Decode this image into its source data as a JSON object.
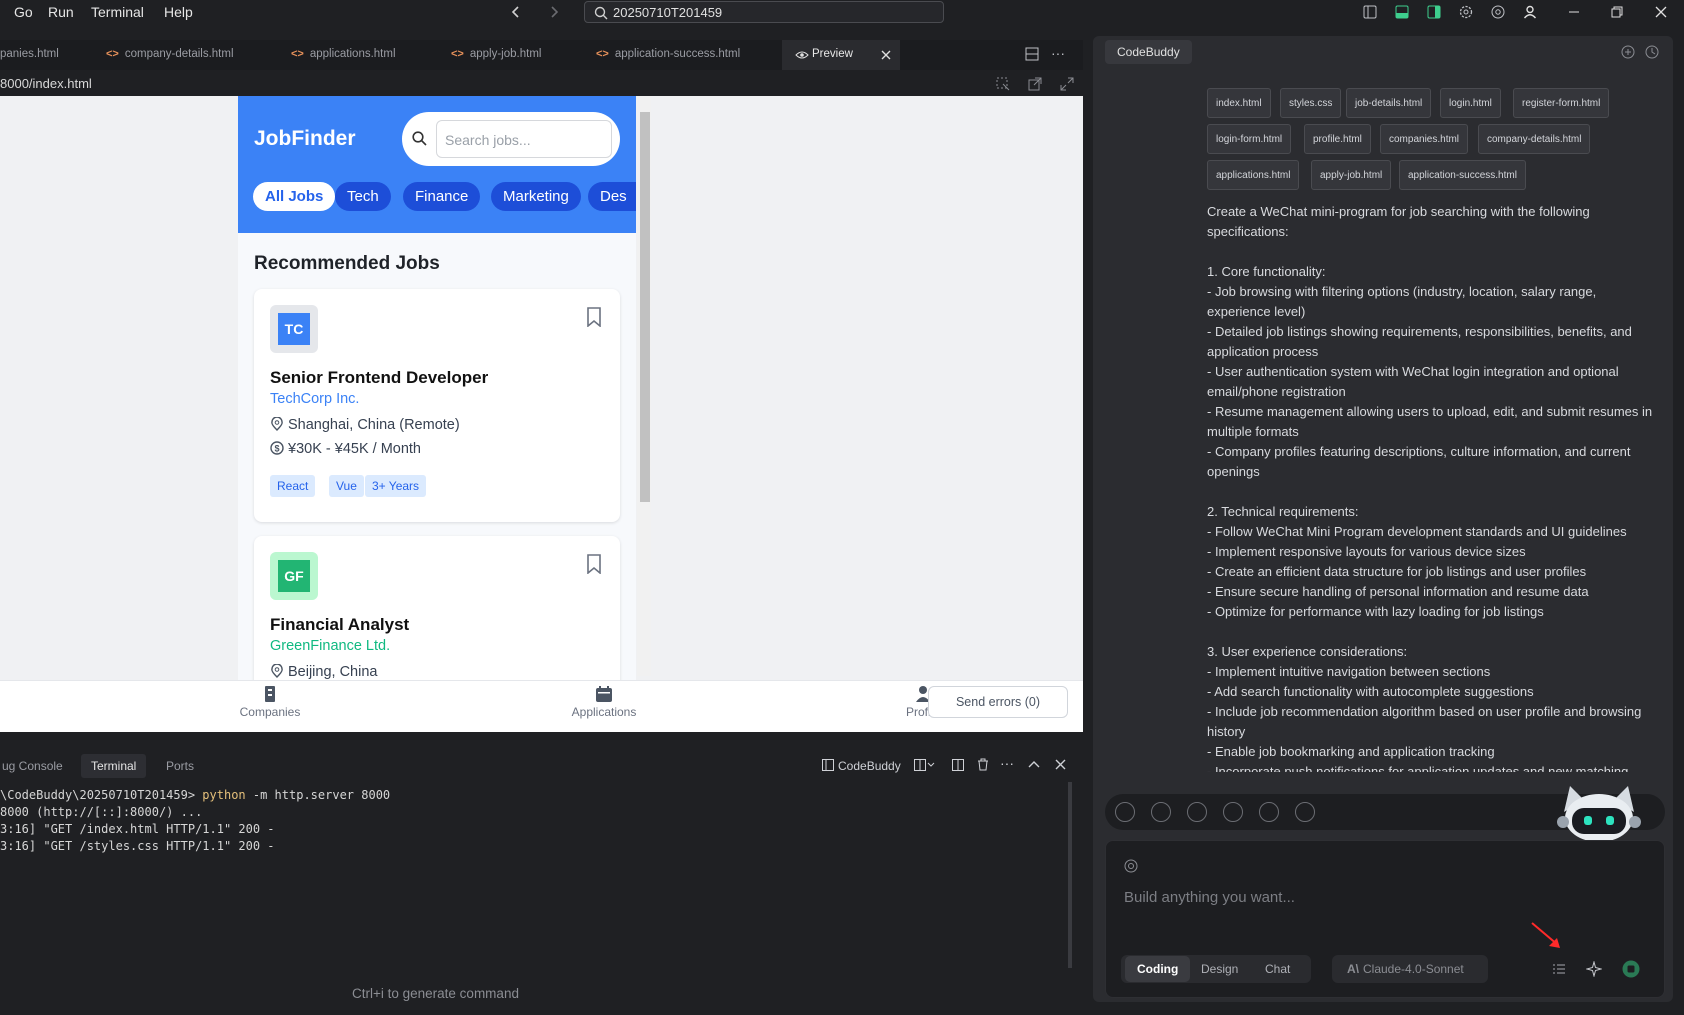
{
  "titlebar": {
    "menus": [
      "Go",
      "Run",
      "Terminal",
      "Help"
    ],
    "search_text": "20250710T201459"
  },
  "tabs": [
    "panies.html",
    "company-details.html",
    "applications.html",
    "apply-job.html",
    "application-success.html",
    "Preview"
  ],
  "url": "8000/index.html",
  "app": {
    "brand": "JobFinder",
    "search_placeholder": "Search jobs...",
    "categories": [
      "All Jobs",
      "Tech",
      "Finance",
      "Marketing",
      "Des"
    ],
    "section_title": "Recommended Jobs",
    "jobs": [
      {
        "logo": "TC",
        "title": "Senior Frontend Developer",
        "company": "TechCorp Inc.",
        "location": "Shanghai, China (Remote)",
        "salary": "¥30K - ¥45K / Month",
        "tags": [
          "React",
          "Vue",
          "3+ Years"
        ],
        "logo_bg": "#e5e7eb",
        "logo_fg": "#3b82f6",
        "company_color": "#3b82f6"
      },
      {
        "logo": "GF",
        "title": "Financial Analyst",
        "company": "GreenFinance Ltd.",
        "location": "Beijing, China",
        "logo_bg": "#bbf7d0",
        "logo_fg": "#22b573",
        "company_color": "#10b981"
      }
    ],
    "nav": [
      "Companies",
      "Applications",
      "Profile"
    ],
    "send_errors": "Send errors (0)"
  },
  "terminal": {
    "tabs": [
      "ug Console",
      "Terminal",
      "Ports"
    ],
    "codebuddy_label": "CodeBuddy",
    "lines": [
      {
        "pre": "\\CodeBuddy\\20250710T201459> ",
        "kw": "python",
        "post": " -m http.server 8000"
      },
      {
        "pre": "8000 (http://[::]:8000/) ...",
        "kw": "",
        "post": ""
      },
      {
        "pre": "3:16] \"GET /index.html HTTP/1.1\" 200 -",
        "kw": "",
        "post": ""
      },
      {
        "pre": "3:16] \"GET /styles.css HTTP/1.1\" 200 -",
        "kw": "",
        "post": ""
      }
    ],
    "hint": "Ctrl+i to generate command"
  },
  "codebuddy": {
    "tab": "CodeBuddy",
    "files": [
      [
        "index.html",
        "styles.css",
        "job-details.html",
        "login.html",
        "register-form.html"
      ],
      [
        "login-form.html",
        "profile.html",
        "companies.html",
        "company-details.html"
      ],
      [
        "applications.html",
        "apply-job.html",
        "application-success.html"
      ]
    ],
    "prompt": [
      "Create a WeChat mini-program for job searching with the following specifications:",
      "",
      "1. Core functionality:",
      "- Job browsing with filtering options (industry, location, salary range, experience level)",
      "- Detailed job listings showing requirements, responsibilities, benefits, and application process",
      "- User authentication system with WeChat login integration and optional email/phone registration",
      "- Resume management allowing users to upload, edit, and submit resumes in multiple formats",
      "- Company profiles featuring descriptions, culture information, and current openings",
      "",
      "2. Technical requirements:",
      "- Follow WeChat Mini Program development standards and UI guidelines",
      "- Implement responsive layouts for various device sizes",
      "- Create an efficient data structure for job listings and user profiles",
      "- Ensure secure handling of personal information and resume data",
      "- Optimize for performance with lazy loading for job listings",
      "",
      "3. User experience considerations:",
      "- Implement intuitive navigation between sections",
      "- Add search functionality with autocomplete suggestions",
      "- Include job recommendation algorithm based on user profile and browsing history",
      "- Enable job bookmarking and application tracking",
      "- Incorporate push notifications for application updates and new matching"
    ],
    "input_placeholder": "Build anything you want...",
    "modes": [
      "Coding",
      "Design",
      "Chat"
    ],
    "model": "Claude-4.0-Sonnet"
  }
}
